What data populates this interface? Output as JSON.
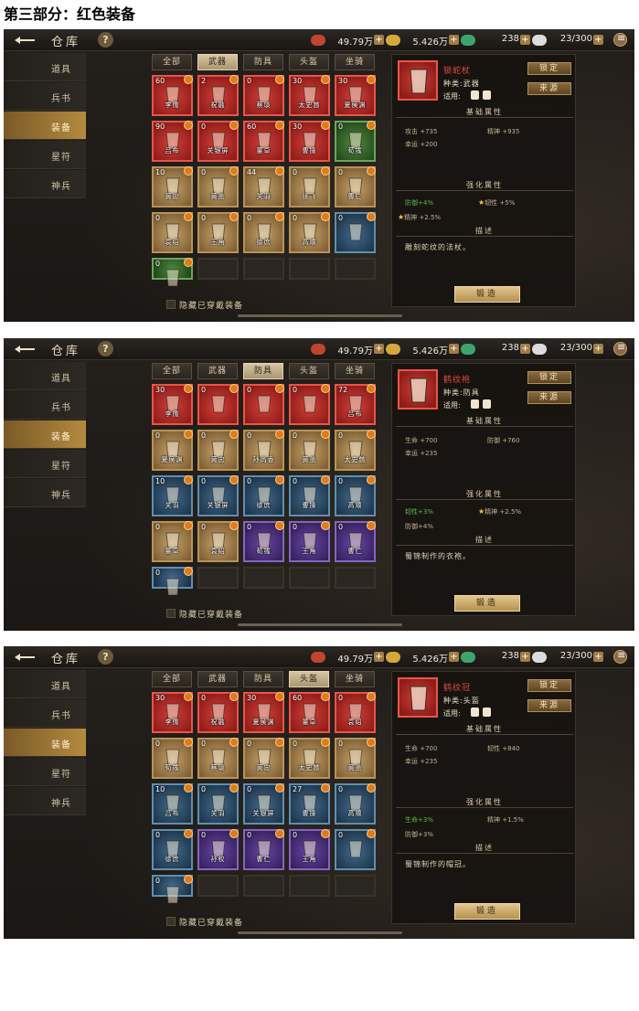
{
  "doc_title": "第三部分：红色装备",
  "colors": {
    "red_frame": "#e85549",
    "gold_frame": "#b89356",
    "blue_frame": "#5d8fb1",
    "purple_frame": "#8664c0",
    "green_frame": "#6aa65a",
    "accent_gold": "#b38a3e"
  },
  "screens": [
    {
      "window_title": "仓库",
      "resources": {
        "silver": "49.79万",
        "coin": "5.426万",
        "jade": "238",
        "capacity": "23/300"
      },
      "sidebar": [
        "道具",
        "兵书",
        "装备",
        "星符",
        "神兵"
      ],
      "active_sidebar": 2,
      "tabs": [
        "全部",
        "武器",
        "防具",
        "头盔",
        "坐骑"
      ],
      "active_tab": 1,
      "items": [
        {
          "lvl": "60",
          "name": "李儒",
          "rarity": "red"
        },
        {
          "lvl": "2",
          "name": "祝融",
          "rarity": "red"
        },
        {
          "lvl": "0",
          "name": "蔡琰",
          "rarity": "red"
        },
        {
          "lvl": "30",
          "name": "太史慈",
          "rarity": "red"
        },
        {
          "lvl": "30",
          "name": "夏侯渊",
          "rarity": "red"
        },
        {
          "lvl": "90",
          "name": "吕布",
          "rarity": "red"
        },
        {
          "lvl": "0",
          "name": "关银屏",
          "rarity": "red"
        },
        {
          "lvl": "60",
          "name": "董卓",
          "rarity": "red"
        },
        {
          "lvl": "30",
          "name": "曹操",
          "rarity": "red"
        },
        {
          "lvl": "0",
          "name": "荀彧",
          "rarity": "green"
        },
        {
          "lvl": "10",
          "name": "黄忠",
          "rarity": "gold"
        },
        {
          "lvl": "0",
          "name": "黄盖",
          "rarity": "gold"
        },
        {
          "lvl": "44",
          "name": "关羽",
          "rarity": "gold"
        },
        {
          "lvl": "0",
          "name": "张飞",
          "rarity": "gold"
        },
        {
          "lvl": "0",
          "name": "曹仁",
          "rarity": "gold"
        },
        {
          "lvl": "0",
          "name": "袁绍",
          "rarity": "gold"
        },
        {
          "lvl": "0",
          "name": "王角",
          "rarity": "gold"
        },
        {
          "lvl": "0",
          "name": "徐庶",
          "rarity": "gold"
        },
        {
          "lvl": "0",
          "name": "高顺",
          "rarity": "gold"
        },
        {
          "lvl": "0",
          "name": "",
          "rarity": "blue"
        },
        {
          "lvl": "0",
          "name": "",
          "rarity": "green"
        },
        {
          "lvl": "",
          "name": "",
          "rarity": "empty"
        },
        {
          "lvl": "",
          "name": "",
          "rarity": "empty"
        },
        {
          "lvl": "",
          "name": "",
          "rarity": "empty"
        },
        {
          "lvl": "",
          "name": "",
          "rarity": "empty"
        }
      ],
      "hide_equipped": "隐藏已穿戴装备",
      "detail": {
        "name": "锁蛇杖",
        "type": "种类:武器",
        "use": "适用:",
        "lock_btn": "锁定",
        "source_btn": "来源",
        "base_title": "基础属性",
        "base": [
          {
            "l": "攻击 +735",
            "r": "精神 +935"
          },
          {
            "l": "幸运 +200",
            "r": ""
          }
        ],
        "enh_title": "强化属性",
        "enh": [
          {
            "l": "防御+4%",
            "r": "韧性 +5%",
            "rstar": true,
            "lgreen": true,
            "rgreen": false
          },
          {
            "l": "精神 +2.5%",
            "lstar": true
          }
        ],
        "desc_title": "描述",
        "desc": "雕刻蛇纹的法杖。",
        "forge": "锻造"
      }
    },
    {
      "window_title": "仓库",
      "resources": {
        "silver": "49.79万",
        "coin": "5.426万",
        "jade": "238",
        "capacity": "23/300"
      },
      "sidebar": [
        "道具",
        "兵书",
        "装备",
        "星符",
        "神兵"
      ],
      "active_sidebar": 2,
      "tabs": [
        "全部",
        "武器",
        "防具",
        "头盔",
        "坐骑"
      ],
      "active_tab": 2,
      "items": [
        {
          "lvl": "30",
          "name": "李儒",
          "rarity": "red"
        },
        {
          "lvl": "0",
          "name": "",
          "rarity": "red"
        },
        {
          "lvl": "0",
          "name": "",
          "rarity": "red"
        },
        {
          "lvl": "0",
          "name": "",
          "rarity": "red"
        },
        {
          "lvl": "72",
          "name": "吕布",
          "rarity": "red"
        },
        {
          "lvl": "0",
          "name": "夏侯渊",
          "rarity": "gold"
        },
        {
          "lvl": "0",
          "name": "黄忠",
          "rarity": "gold"
        },
        {
          "lvl": "0",
          "name": "孙尚香",
          "rarity": "gold"
        },
        {
          "lvl": "0",
          "name": "黄盖",
          "rarity": "gold"
        },
        {
          "lvl": "0",
          "name": "太史慈",
          "rarity": "gold"
        },
        {
          "lvl": "10",
          "name": "关羽",
          "rarity": "blue"
        },
        {
          "lvl": "0",
          "name": "关银屏",
          "rarity": "blue"
        },
        {
          "lvl": "0",
          "name": "徐庶",
          "rarity": "blue"
        },
        {
          "lvl": "0",
          "name": "曹操",
          "rarity": "blue"
        },
        {
          "lvl": "0",
          "name": "高顺",
          "rarity": "blue"
        },
        {
          "lvl": "0",
          "name": "董卓",
          "rarity": "gold"
        },
        {
          "lvl": "0",
          "name": "袁绍",
          "rarity": "gold"
        },
        {
          "lvl": "0",
          "name": "荀彧",
          "rarity": "purple"
        },
        {
          "lvl": "0",
          "name": "王角",
          "rarity": "purple"
        },
        {
          "lvl": "0",
          "name": "曹仁",
          "rarity": "purple"
        },
        {
          "lvl": "0",
          "name": "",
          "rarity": "blue"
        },
        {
          "lvl": "",
          "name": "",
          "rarity": "empty"
        },
        {
          "lvl": "",
          "name": "",
          "rarity": "empty"
        },
        {
          "lvl": "",
          "name": "",
          "rarity": "empty"
        },
        {
          "lvl": "",
          "name": "",
          "rarity": "empty"
        }
      ],
      "hide_equipped": "隐藏已穿戴装备",
      "detail": {
        "name": "鹤纹袍",
        "type": "种类:防具",
        "use": "适用:",
        "lock_btn": "锁定",
        "source_btn": "来源",
        "base_title": "基础属性",
        "base": [
          {
            "l": "生命 +700",
            "r": "防御 +760"
          },
          {
            "l": "幸运 +235",
            "r": ""
          }
        ],
        "enh_title": "强化属性",
        "enh": [
          {
            "l": "韧性+3%",
            "r": "精神 +2.5%",
            "rstar": true,
            "lgreen": true,
            "rgreen": false
          },
          {
            "l": "防御+4%",
            "lstar": false
          }
        ],
        "desc_title": "描述",
        "desc": "蜀锦制作的衣袍。",
        "forge": "锻造"
      }
    },
    {
      "window_title": "仓库",
      "resources": {
        "silver": "49.79万",
        "coin": "5.426万",
        "jade": "238",
        "capacity": "23/300"
      },
      "sidebar": [
        "道具",
        "兵书",
        "装备",
        "星符",
        "神兵"
      ],
      "active_sidebar": 2,
      "tabs": [
        "全部",
        "武器",
        "防具",
        "头盔",
        "坐骑"
      ],
      "active_tab": 3,
      "items": [
        {
          "lvl": "30",
          "name": "李儒",
          "rarity": "red"
        },
        {
          "lvl": "0",
          "name": "祝融",
          "rarity": "red"
        },
        {
          "lvl": "30",
          "name": "夏侯渊",
          "rarity": "red"
        },
        {
          "lvl": "60",
          "name": "董卓",
          "rarity": "red"
        },
        {
          "lvl": "0",
          "name": "袁绍",
          "rarity": "red"
        },
        {
          "lvl": "0",
          "name": "荀彧",
          "rarity": "gold"
        },
        {
          "lvl": "0",
          "name": "蔡琰",
          "rarity": "gold"
        },
        {
          "lvl": "0",
          "name": "黄忠",
          "rarity": "gold"
        },
        {
          "lvl": "0",
          "name": "太史慈",
          "rarity": "gold"
        },
        {
          "lvl": "0",
          "name": "黄盖",
          "rarity": "gold"
        },
        {
          "lvl": "10",
          "name": "吕布",
          "rarity": "blue"
        },
        {
          "lvl": "0",
          "name": "关羽",
          "rarity": "blue"
        },
        {
          "lvl": "0",
          "name": "关银屏",
          "rarity": "blue"
        },
        {
          "lvl": "27",
          "name": "曹操",
          "rarity": "blue"
        },
        {
          "lvl": "0",
          "name": "高顺",
          "rarity": "blue"
        },
        {
          "lvl": "0",
          "name": "徐庶",
          "rarity": "blue"
        },
        {
          "lvl": "0",
          "name": "孙权",
          "rarity": "purple"
        },
        {
          "lvl": "0",
          "name": "曹仁",
          "rarity": "purple"
        },
        {
          "lvl": "0",
          "name": "王角",
          "rarity": "purple"
        },
        {
          "lvl": "0",
          "name": "",
          "rarity": "blue"
        },
        {
          "lvl": "0",
          "name": "",
          "rarity": "blue"
        },
        {
          "lvl": "",
          "name": "",
          "rarity": "empty"
        },
        {
          "lvl": "",
          "name": "",
          "rarity": "empty"
        },
        {
          "lvl": "",
          "name": "",
          "rarity": "empty"
        },
        {
          "lvl": "",
          "name": "",
          "rarity": "empty"
        }
      ],
      "hide_equipped": "隐藏已穿戴装备",
      "detail": {
        "name": "鹤纹冠",
        "type": "种类:头盔",
        "use": "适用:",
        "lock_btn": "锁定",
        "source_btn": "来源",
        "base_title": "基础属性",
        "base": [
          {
            "l": "生命 +700",
            "r": "韧性 +840"
          },
          {
            "l": "幸运 +235",
            "r": ""
          }
        ],
        "enh_title": "强化属性",
        "enh": [
          {
            "l": "生命+3%",
            "r": "精神 +1.5%",
            "rstar": false,
            "lgreen": true,
            "rgreen": false
          },
          {
            "l": "防御+3%",
            "lstar": false
          }
        ],
        "desc_title": "描述",
        "desc": "蜀锦制作的帽冠。",
        "forge": "锻造"
      }
    }
  ]
}
